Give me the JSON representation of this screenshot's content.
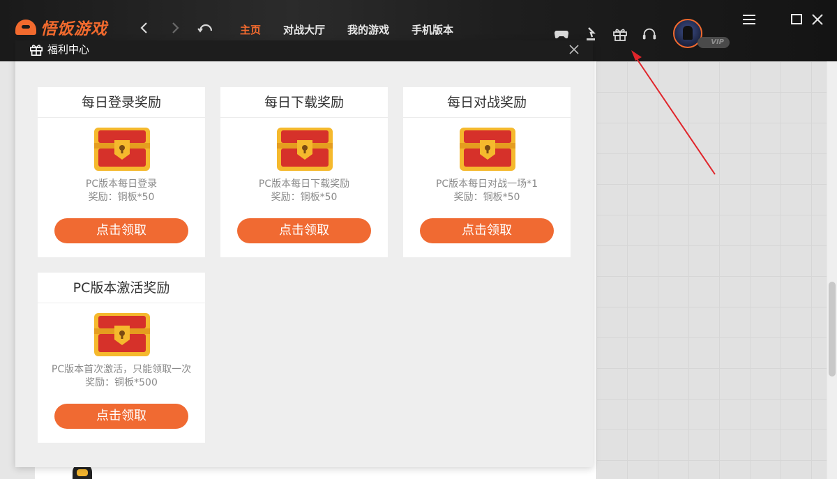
{
  "app": {
    "brand": "悟饭游戏",
    "tabs": [
      {
        "label": "主页",
        "active": true
      },
      {
        "label": "对战大厅",
        "active": false
      },
      {
        "label": "我的游戏",
        "active": false
      },
      {
        "label": "手机版本",
        "active": false
      }
    ],
    "vip_badge": "VIP",
    "toolbar_icons": [
      "gamepad-icon",
      "download-icon",
      "gift-icon",
      "headset-icon"
    ],
    "accent_color": "#f26a2e"
  },
  "dialog": {
    "title": "福利中心",
    "cards": [
      {
        "title": "每日登录奖励",
        "desc_line1": "PC版本每日登录",
        "desc_line2": "奖励：铜板*50",
        "button": "点击领取"
      },
      {
        "title": "每日下载奖励",
        "desc_line1": "PC版本每日下载奖励",
        "desc_line2": "奖励：铜板*50",
        "button": "点击领取"
      },
      {
        "title": "每日对战奖励",
        "desc_line1": "PC版本每日对战一场*1",
        "desc_line2": "奖励：铜板*50",
        "button": "点击领取"
      },
      {
        "title": "PC版本激活奖励",
        "desc_line1": "PC版本首次激活，只能领取一次",
        "desc_line2": "奖励：铜板*500",
        "button": "点击领取"
      }
    ]
  }
}
